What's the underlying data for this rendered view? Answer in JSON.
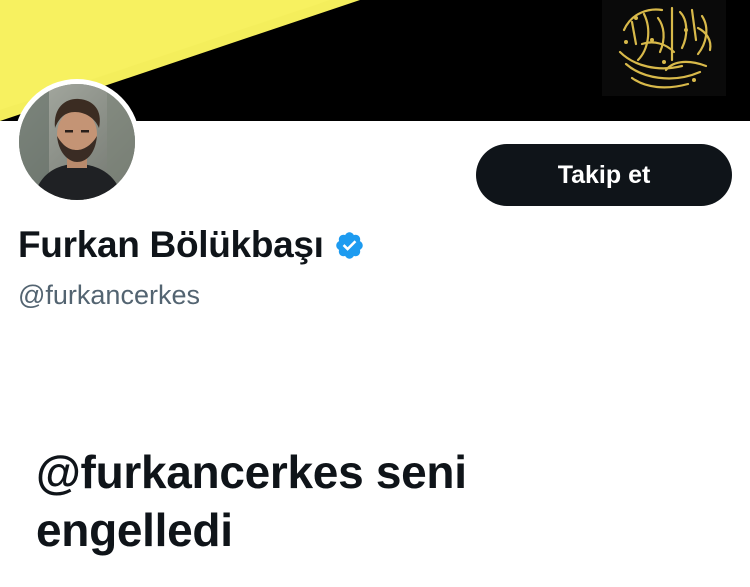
{
  "header": {
    "banner_colors": {
      "yellow": "#f7f05a",
      "black": "#000000",
      "gold": "#d8b94a"
    }
  },
  "profile": {
    "avatar_icon": "profile-photo",
    "display_name": "Furkan Bölükbaşı",
    "verified_icon": "verified-badge-icon",
    "verified_color": "#1d9bf0",
    "handle": "@furkancerkes",
    "follow_label": "Takip et"
  },
  "notice": {
    "line1": "@furkancerkes seni",
    "line2": "engelledi"
  }
}
